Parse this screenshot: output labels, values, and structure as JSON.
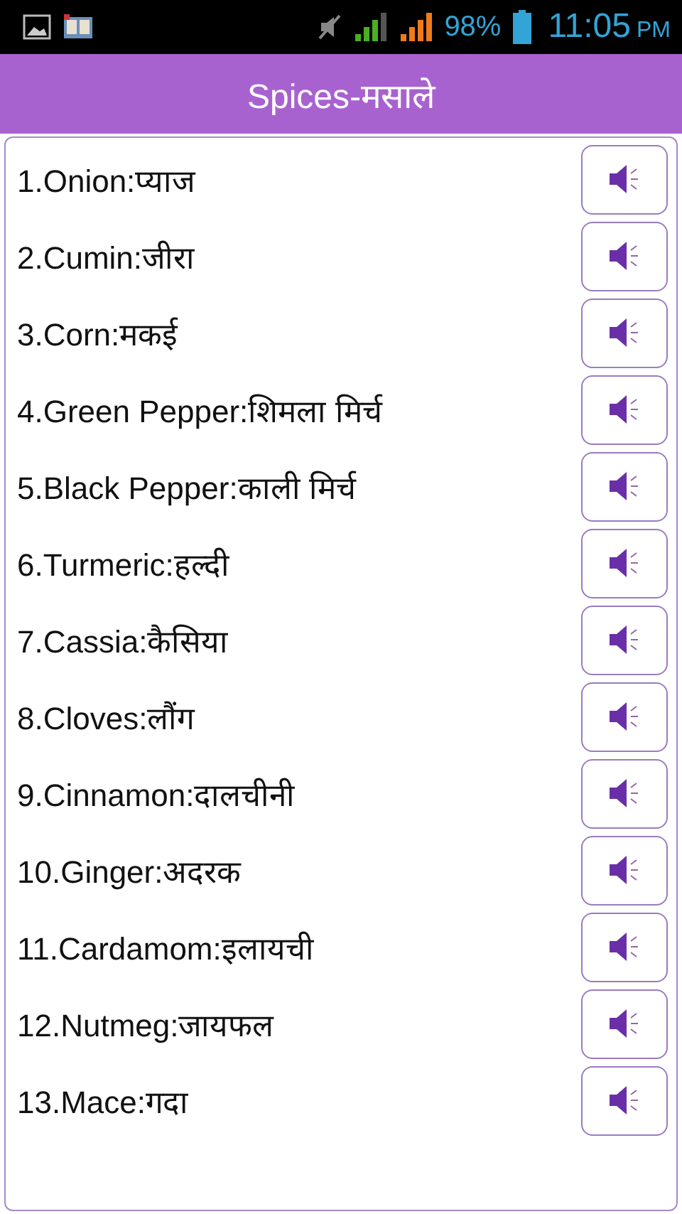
{
  "status_bar": {
    "battery": "98%",
    "time": "11:05",
    "ampm": "PM"
  },
  "title": "Spices-मसाले",
  "items": [
    {
      "label": "1.Onion:प्याज"
    },
    {
      "label": "2.Cumin:जीरा"
    },
    {
      "label": "3.Corn:मकई"
    },
    {
      "label": "4.Green Pepper:शिमला मिर्च"
    },
    {
      "label": "5.Black Pepper:काली मिर्च"
    },
    {
      "label": "6.Turmeric:हल्दी"
    },
    {
      "label": "7.Cassia:कैसिया"
    },
    {
      "label": "8.Cloves:लौंग"
    },
    {
      "label": "9.Cinnamon:दालचीनी"
    },
    {
      "label": "10.Ginger:अदरक"
    },
    {
      "label": "11.Cardamom:इलायची"
    },
    {
      "label": "12.Nutmeg:जायफल"
    },
    {
      "label": "13.Mace:गदा"
    }
  ]
}
